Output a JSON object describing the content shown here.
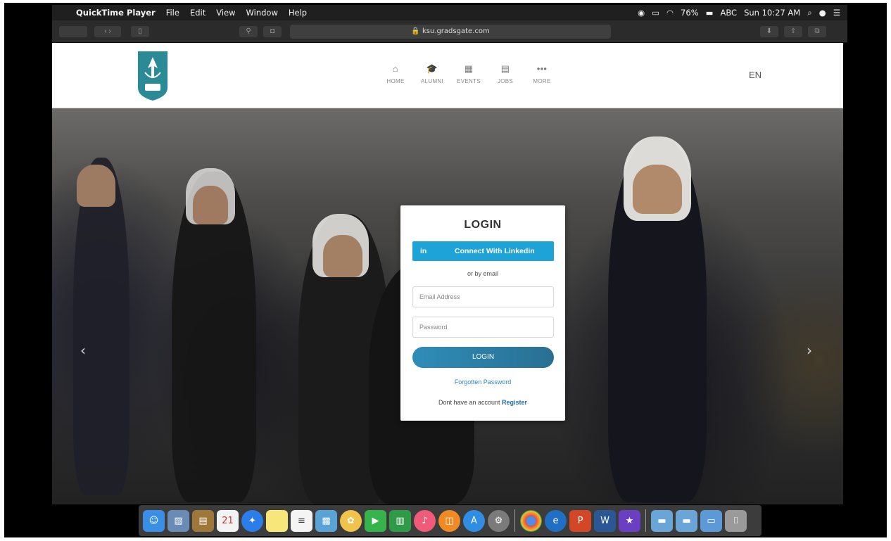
{
  "menubar": {
    "apple": "",
    "app": "QuickTime Player",
    "items": [
      "File",
      "Edit",
      "View",
      "Window",
      "Help"
    ],
    "battery": "76%",
    "input": "ABC",
    "clock": "Sun 10:27 AM"
  },
  "browser": {
    "url": "ksu.gradsgate.com"
  },
  "site": {
    "nav": [
      {
        "label": "HOME",
        "icon": "home-icon",
        "glyph": "⌂"
      },
      {
        "label": "ALUMNI",
        "icon": "graduation-cap-icon",
        "glyph": "🎓"
      },
      {
        "label": "EVENTS",
        "icon": "calendar-icon",
        "glyph": "▦"
      },
      {
        "label": "JOBS",
        "icon": "briefcase-icon",
        "glyph": "▤"
      },
      {
        "label": "MORE",
        "icon": "more-dots-icon",
        "glyph": "•••"
      }
    ],
    "lang": "EN"
  },
  "login": {
    "title": "LOGIN",
    "linkedin_in": "in",
    "linkedin_label": "Connect With Linkedin",
    "or_by_email": "or by email",
    "email_placeholder": "Email Address",
    "password_placeholder": "Password",
    "submit": "LOGIN",
    "forgot": "Forgotten Password",
    "no_account": "Dont have an account",
    "register": "Register"
  },
  "hero": {
    "prev": "‹",
    "next": "›"
  },
  "colors": {
    "linkedin": "#1da3d8",
    "login_button": "#2e8db8",
    "logo": "#2a8b96"
  },
  "dock": [
    "finder-icon",
    "preview-icon",
    "notes-icon",
    "calendar-icon",
    "safari-icon",
    "stickies-icon",
    "textedit-icon",
    "photos-icon",
    "photos-app-icon",
    "facetime-icon",
    "numbers-icon",
    "music-icon",
    "books-icon",
    "app-store-icon",
    "system-preferences-icon",
    "chrome-icon",
    "edge-icon",
    "powerpoint-icon",
    "word-icon",
    "imovie-icon",
    "folder-icon",
    "folder-icon-2",
    "folder-icon-3",
    "trash-icon"
  ]
}
